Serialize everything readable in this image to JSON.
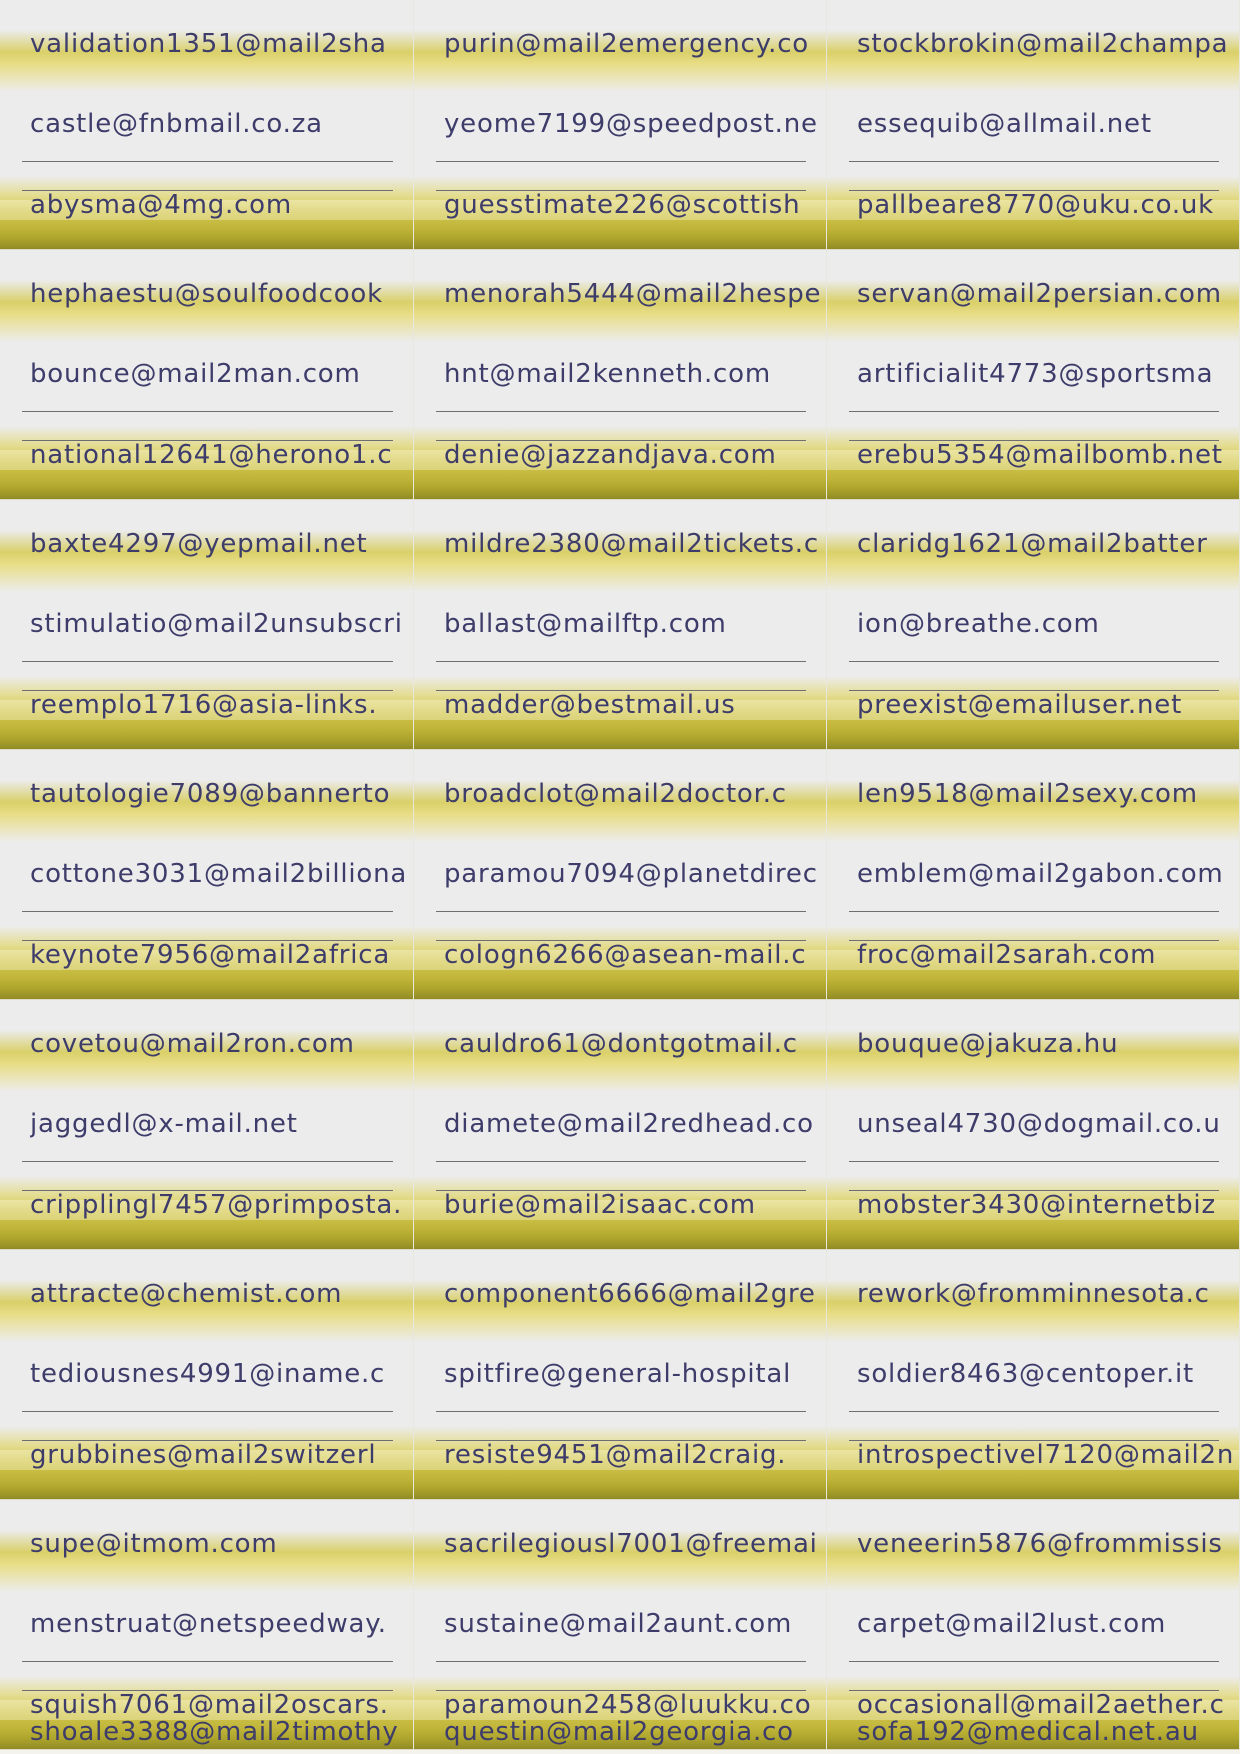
{
  "cards": [
    {
      "emails": [
        "validation1351@mail2sha",
        "castle@fnbmail.co.za",
        "abysma@4mg.com"
      ]
    },
    {
      "emails": [
        "purin@mail2emergency.co",
        "yeome7199@speedpost.ne",
        "guesstimate226@scottish"
      ]
    },
    {
      "emails": [
        "stockbrokin@mail2champa",
        "essequib@allmail.net",
        "pallbeare8770@uku.co.uk"
      ]
    },
    {
      "emails": [
        "hephaestu@soulfoodcook",
        "bounce@mail2man.com",
        "national12641@herono1.c"
      ]
    },
    {
      "emails": [
        "menorah5444@mail2hespe",
        "hnt@mail2kenneth.com",
        "denie@jazzandjava.com"
      ]
    },
    {
      "emails": [
        "servan@mail2persian.com",
        "artificialit4773@sportsma",
        "erebu5354@mailbomb.net"
      ]
    },
    {
      "emails": [
        "baxte4297@yepmail.net",
        "stimulatio@mail2unsubscri",
        "reemplo1716@asia-links."
      ]
    },
    {
      "emails": [
        "mildre2380@mail2tickets.c",
        "ballast@mailftp.com",
        "madder@bestmail.us"
      ]
    },
    {
      "emails": [
        "claridg1621@mail2batter",
        "ion@breathe.com",
        "preexist@emailuser.net"
      ]
    },
    {
      "emails": [
        "tautologie7089@bannerto",
        "cottone3031@mail2billiona",
        "keynote7956@mail2africa"
      ]
    },
    {
      "emails": [
        "broadclot@mail2doctor.c",
        "paramou7094@planetdirec",
        "cologn6266@asean-mail.c"
      ]
    },
    {
      "emails": [
        "len9518@mail2sexy.com",
        "emblem@mail2gabon.com",
        "froc@mail2sarah.com"
      ]
    },
    {
      "emails": [
        "covetou@mail2ron.com",
        "jaggedl@x-mail.net",
        "cripplingl7457@primposta."
      ]
    },
    {
      "emails": [
        "cauldro61@dontgotmail.c",
        "diamete@mail2redhead.co",
        "burie@mail2isaac.com"
      ]
    },
    {
      "emails": [
        "bouque@jakuza.hu",
        "unseal4730@dogmail.co.u",
        "mobster3430@internetbiz"
      ]
    },
    {
      "emails": [
        "attracte@chemist.com",
        "tediousnes4991@iname.c",
        "grubbines@mail2switzerl"
      ]
    },
    {
      "emails": [
        "component6666@mail2gre",
        "spitfire@general-hospital",
        "resiste9451@mail2craig."
      ]
    },
    {
      "emails": [
        "rework@fromminnesota.c",
        "soldier8463@centoper.it",
        "introspectivel7120@mail2n"
      ]
    },
    {
      "emails": [
        "supe@itmom.com",
        "menstruat@netspeedway.",
        "squish7061@mail2oscars."
      ]
    },
    {
      "emails": [
        "sacrilegiousl7001@freemai",
        "sustaine@mail2aunt.com",
        "paramoun2458@luukku.co"
      ]
    },
    {
      "emails": [
        "veneerin5876@frommissis",
        "carpet@mail2lust.com",
        "occasionall@mail2aether.c"
      ]
    }
  ],
  "bottom_row": {
    "emails": [
      "shoale3388@mail2timothy",
      "questin@mail2georgia.co",
      "sofa192@medical.net.au"
    ]
  }
}
